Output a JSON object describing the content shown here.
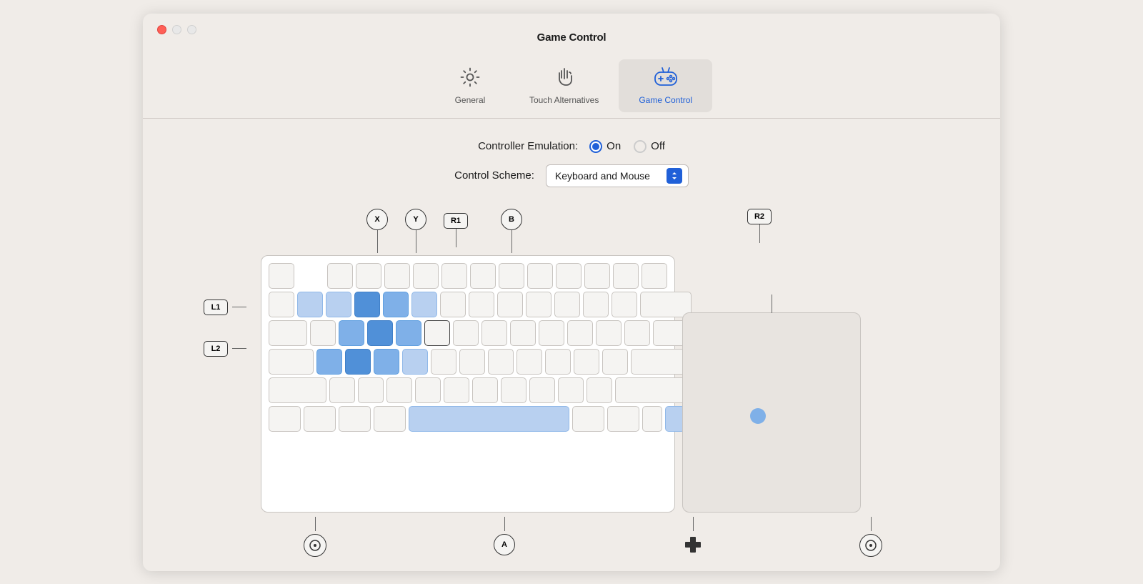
{
  "window": {
    "title": "Game Control"
  },
  "traffic_lights": {
    "close": "close",
    "minimize": "minimize",
    "maximize": "maximize"
  },
  "tabs": [
    {
      "id": "general",
      "label": "General",
      "icon": "gear",
      "active": false
    },
    {
      "id": "touch",
      "label": "Touch Alternatives",
      "icon": "hand",
      "active": false
    },
    {
      "id": "gamecontrol",
      "label": "Game Control",
      "icon": "gamepad",
      "active": true
    }
  ],
  "settings": {
    "controller_emulation_label": "Controller Emulation:",
    "on_label": "On",
    "off_label": "Off",
    "emulation_on": true,
    "control_scheme_label": "Control Scheme:",
    "control_scheme_value": "Keyboard and Mouse"
  },
  "diagram": {
    "top_labels": [
      {
        "id": "X",
        "label": "X",
        "shape": "circle",
        "x_pct": 23
      },
      {
        "id": "Y",
        "label": "Y",
        "shape": "circle",
        "x_pct": 31
      },
      {
        "id": "R1",
        "label": "R1",
        "shape": "rect",
        "x_pct": 39
      },
      {
        "id": "B",
        "label": "B",
        "shape": "circle",
        "x_pct": 48
      }
    ],
    "right_top_label": {
      "id": "R2",
      "label": "R2",
      "shape": "rect"
    },
    "left_labels": [
      {
        "id": "L1",
        "label": "L1",
        "shape": "rect",
        "y_pct": 38
      },
      {
        "id": "L2",
        "label": "L2",
        "shape": "rect",
        "y_pct": 64
      }
    ],
    "bottom_labels": [
      {
        "id": "L",
        "label": "L",
        "shape": "circle-joystick"
      },
      {
        "id": "A",
        "label": "A",
        "shape": "circle"
      },
      {
        "id": "dpad",
        "label": "",
        "shape": "dpad"
      },
      {
        "id": "R",
        "label": "R",
        "shape": "circle-joystick"
      }
    ]
  },
  "colors": {
    "active_tab_bg": "#e2deda",
    "active_tab_text": "#2060d8",
    "blue_light": "#b8d0f0",
    "blue_mid": "#7fb0e8",
    "blue_dark": "#5090d8",
    "select_btn": "#2060d8",
    "trackpad_dot": "#7fb0e8"
  }
}
